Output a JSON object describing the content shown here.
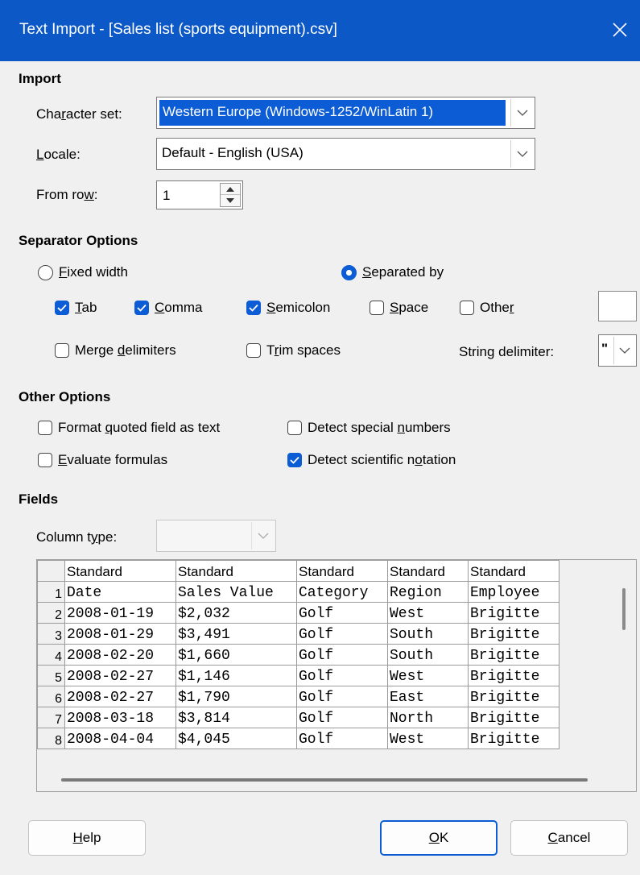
{
  "window": {
    "title": "Text Import - [Sales list (sports equipment).csv]"
  },
  "import": {
    "heading": "Import",
    "charset_label_pre": "Cha",
    "charset_label_u": "r",
    "charset_label_post": "acter set:",
    "charset_value": "Western Europe (Windows-1252/WinLatin 1)",
    "locale_label_u": "L",
    "locale_label_post": "ocale:",
    "locale_value": "Default - English (USA)",
    "fromrow_label_pre": "From ro",
    "fromrow_label_u": "w",
    "fromrow_label_post": ":",
    "fromrow_value": "1"
  },
  "separator": {
    "heading": "Separator Options",
    "fixed_u": "F",
    "fixed_post": "ixed width",
    "separated_u": "S",
    "separated_post": "eparated by",
    "tab_u": "T",
    "tab_post": "ab",
    "comma_u": "C",
    "comma_post": "omma",
    "semicolon_u": "S",
    "semicolon_post": "emicolon",
    "space_u": "S",
    "space_post": "pace",
    "other_pre": "Othe",
    "other_u": "r",
    "merge_pre": "Merge ",
    "merge_u": "d",
    "merge_post": "elimiters",
    "trim_pre": "T",
    "trim_u": "r",
    "trim_post": "im spaces",
    "string_pre": "Strin",
    "string_u": "g",
    "string_post": " delimiter:",
    "string_value": "\""
  },
  "other_options": {
    "heading": "Other Options",
    "quoted_pre": "Format ",
    "quoted_u": "q",
    "quoted_post": "uoted field as text",
    "special_pre": "Detect special ",
    "special_u": "n",
    "special_post": "umbers",
    "evaluate_u": "E",
    "evaluate_post": "valuate formulas",
    "scientific_pre": "Detect scientific n",
    "scientific_u": "o",
    "scientific_post": "tation"
  },
  "fields": {
    "heading": "Fields",
    "coltype_pre": "Column t",
    "coltype_u": "y",
    "coltype_post": "pe:",
    "coltype_value": "",
    "column_types": [
      "Standard",
      "Standard",
      "Standard",
      "Standard",
      "Standard"
    ],
    "rows": [
      {
        "num": "1",
        "cells": [
          "Date",
          "Sales Value",
          "Category",
          "Region",
          "Employee"
        ]
      },
      {
        "num": "2",
        "cells": [
          "2008-01-19",
          "$2,032",
          "Golf",
          "West",
          "Brigitte"
        ]
      },
      {
        "num": "3",
        "cells": [
          "2008-01-29",
          "$3,491",
          "Golf",
          "South",
          "Brigitte"
        ]
      },
      {
        "num": "4",
        "cells": [
          "2008-02-20",
          "$1,660",
          "Golf",
          "South",
          "Brigitte"
        ]
      },
      {
        "num": "5",
        "cells": [
          "2008-02-27",
          "$1,146",
          "Golf",
          "West",
          "Brigitte"
        ]
      },
      {
        "num": "6",
        "cells": [
          "2008-02-27",
          "$1,790",
          "Golf",
          "East",
          "Brigitte"
        ]
      },
      {
        "num": "7",
        "cells": [
          "2008-03-18",
          "$3,814",
          "Golf",
          "North",
          "Brigitte"
        ]
      },
      {
        "num": "8",
        "cells": [
          "2008-04-04",
          "$4,045",
          "Golf",
          "West",
          "Brigitte"
        ]
      }
    ]
  },
  "buttons": {
    "help_u": "H",
    "help_post": "elp",
    "ok_u": "O",
    "ok_post": "K",
    "cancel_u": "C",
    "cancel_post": "ancel"
  },
  "colors": {
    "titlebar": "#0b58c6",
    "accent": "#0b5cd5",
    "background": "#f0f0f0"
  }
}
